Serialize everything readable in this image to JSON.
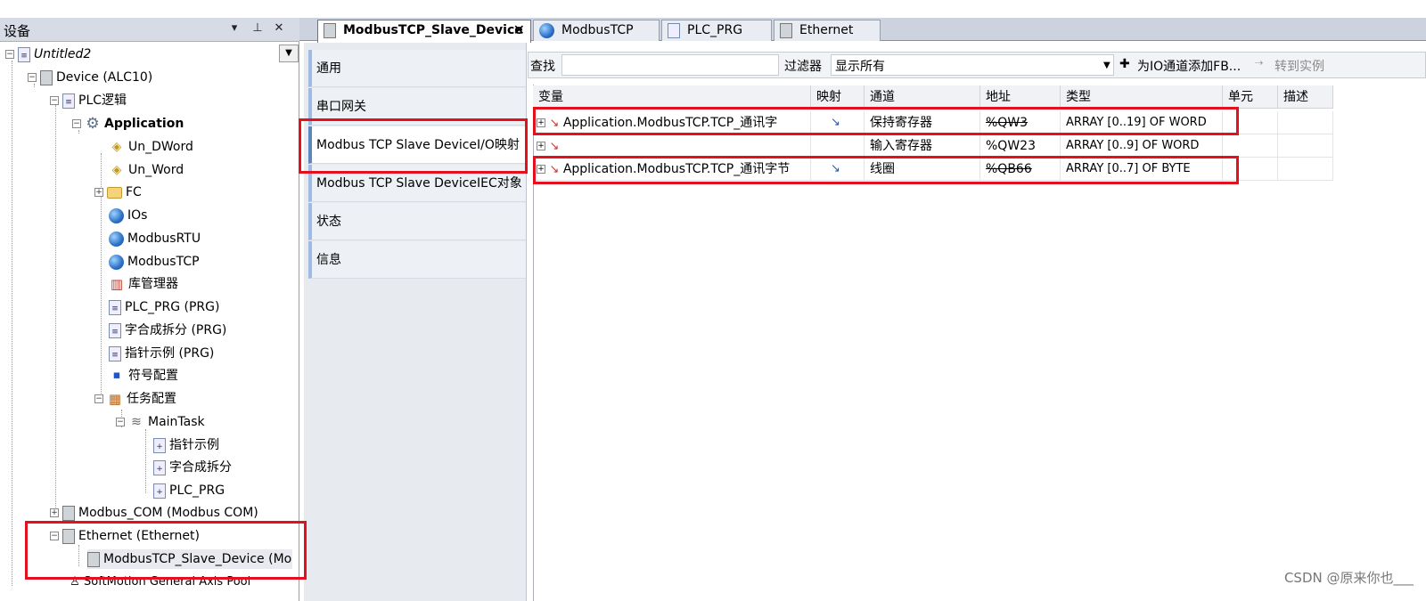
{
  "colors": {
    "highlight": "#e3101e",
    "header_bg": "#d6dbe6",
    "nav_accent": "#5b86c2"
  },
  "left_panel": {
    "title": "设备",
    "pin_glyph": "▾",
    "pushpin_glyph": "⊥",
    "close_glyph": "✕",
    "dropdown_glyph": "▼",
    "tree": [
      {
        "label": "Untitled2",
        "icon": "project-icon"
      },
      {
        "label": "Device (ALC10)",
        "icon": "device-icon"
      },
      {
        "label": "PLC逻辑",
        "icon": "plc-logic-icon"
      },
      {
        "label": "Application",
        "icon": "gear-icon"
      },
      {
        "label": "Un_DWord",
        "icon": "global-var-icon"
      },
      {
        "label": "Un_Word",
        "icon": "global-var-icon"
      },
      {
        "label": "FC",
        "icon": "folder-icon"
      },
      {
        "label": "IOs",
        "icon": "globe-icon"
      },
      {
        "label": "ModbusRTU",
        "icon": "globe-icon"
      },
      {
        "label": "ModbusTCP",
        "icon": "globe-icon"
      },
      {
        "label": "库管理器",
        "icon": "library-icon"
      },
      {
        "label": "PLC_PRG (PRG)",
        "icon": "program-icon"
      },
      {
        "label": "字合成拆分 (PRG)",
        "icon": "program-icon"
      },
      {
        "label": "指针示例 (PRG)",
        "icon": "program-icon"
      },
      {
        "label": "符号配置",
        "icon": "symbol-config-icon"
      },
      {
        "label": "任务配置",
        "icon": "task-config-icon"
      },
      {
        "label": "MainTask",
        "icon": "task-icon"
      },
      {
        "label": "指针示例",
        "icon": "task-call-icon"
      },
      {
        "label": "字合成拆分",
        "icon": "task-call-icon"
      },
      {
        "label": "PLC_PRG",
        "icon": "task-call-icon"
      },
      {
        "label": "Modbus_COM (Modbus COM)",
        "icon": "device-icon"
      },
      {
        "label": "Ethernet (Ethernet)",
        "icon": "device-icon"
      },
      {
        "label": "ModbusTCP_Slave_Device (Modbu",
        "icon": "device-icon"
      },
      {
        "label": "SoftMotion General Axis Pool",
        "icon": "axis-pool-icon"
      }
    ]
  },
  "tabs": [
    {
      "label": "ModbusTCP_Slave_Device",
      "close": "✕"
    },
    {
      "label": "ModbusTCP"
    },
    {
      "label": "PLC_PRG"
    },
    {
      "label": "Ethernet"
    }
  ],
  "nav": [
    {
      "label": "通用"
    },
    {
      "label": "串口网关"
    },
    {
      "label": "Modbus TCP Slave DeviceI/O映射"
    },
    {
      "label": "Modbus TCP Slave DeviceIEC对象"
    },
    {
      "label": "状态"
    },
    {
      "label": "信息"
    }
  ],
  "toolbar": {
    "find_label": "查找",
    "filter_label": "过滤器",
    "filter_value": "显示所有",
    "add_fb_label": "为IO通道添加FB...",
    "goto_instance_label": "转到实例"
  },
  "table": {
    "columns": [
      "变量",
      "映射",
      "通道",
      "地址",
      "类型",
      "单元",
      "描述"
    ],
    "rows": [
      {
        "variable": "Application.ModbusTCP.TCP_通讯字",
        "mapping": "↘",
        "channel": "保持寄存器",
        "address": "%QW3",
        "type": "ARRAY [0..19] OF WORD",
        "unit": "",
        "description": ""
      },
      {
        "variable": "",
        "mapping": "",
        "channel": "输入寄存器",
        "address": "%QW23",
        "type": "ARRAY [0..9] OF WORD",
        "unit": "",
        "description": ""
      },
      {
        "variable": "Application.ModbusTCP.TCP_通讯字节",
        "mapping": "↘",
        "channel": "线圈",
        "address": "%QB66",
        "type": "ARRAY [0..7] OF BYTE",
        "unit": "",
        "description": ""
      }
    ]
  },
  "watermark": "CSDN @原来你也___"
}
